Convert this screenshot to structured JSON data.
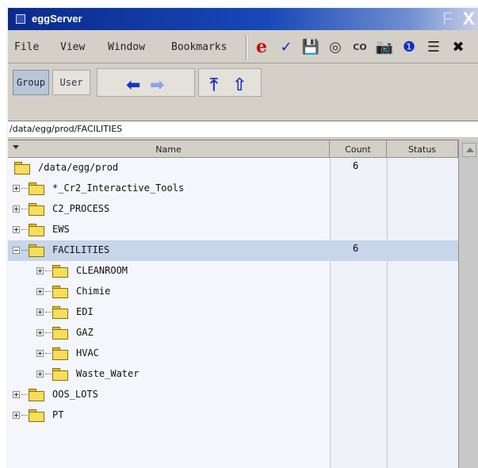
{
  "window": {
    "title": "eggServer",
    "min_glyph": "F",
    "close_glyph": "X"
  },
  "menu": {
    "items": [
      "File",
      "View",
      "Window",
      "Bookmarks"
    ]
  },
  "toolbar": {
    "icons": [
      {
        "name": "e-icon",
        "glyph": "e",
        "color": "#c01010"
      },
      {
        "name": "checkmark-icon",
        "glyph": "✓",
        "color": "#1020c0"
      },
      {
        "name": "save-icon",
        "glyph": "💾",
        "color": "#444444"
      },
      {
        "name": "cd-icon",
        "glyph": "◎",
        "color": "#333333"
      },
      {
        "name": "co-icon",
        "glyph": "CO",
        "color": "#333333"
      },
      {
        "name": "camera-icon",
        "glyph": "📷",
        "color": "#222222"
      },
      {
        "name": "info-icon",
        "glyph": "❶",
        "color": "#1030c0"
      },
      {
        "name": "list-icon",
        "glyph": "☰",
        "color": "#222222"
      },
      {
        "name": "close-icon",
        "glyph": "✖",
        "color": "#111111"
      }
    ]
  },
  "nav": {
    "group_label": "Group",
    "user_label": "User"
  },
  "path": {
    "value": "/data/egg/prod/FACILITIES"
  },
  "table": {
    "columns": [
      "Name",
      "Count",
      "Status"
    ],
    "rows": [
      {
        "label": "/data/egg/prod",
        "count": "6",
        "level": 0,
        "expander": "none",
        "selected": false
      },
      {
        "label": "*_Cr2_Interactive_Tools",
        "count": "",
        "level": 1,
        "expander": "plus",
        "selected": false
      },
      {
        "label": "C2_PROCESS",
        "count": "",
        "level": 1,
        "expander": "plus",
        "selected": false
      },
      {
        "label": "EWS",
        "count": "",
        "level": 1,
        "expander": "plus",
        "selected": false
      },
      {
        "label": "FACILITIES",
        "count": "6",
        "level": 1,
        "expander": "minus",
        "selected": true
      },
      {
        "label": "CLEANROOM",
        "count": "",
        "level": 2,
        "expander": "plus",
        "selected": false
      },
      {
        "label": "Chimie",
        "count": "",
        "level": 2,
        "expander": "plus",
        "selected": false
      },
      {
        "label": "EDI",
        "count": "",
        "level": 2,
        "expander": "plus",
        "selected": false
      },
      {
        "label": "GAZ",
        "count": "",
        "level": 2,
        "expander": "plus",
        "selected": false
      },
      {
        "label": "HVAC",
        "count": "",
        "level": 2,
        "expander": "plus",
        "selected": false
      },
      {
        "label": "Waste_Water",
        "count": "",
        "level": 2,
        "expander": "plus",
        "selected": false
      },
      {
        "label": "OOS_LOTS",
        "count": "",
        "level": 1,
        "expander": "plus",
        "selected": false
      },
      {
        "label": "PT",
        "count": "",
        "level": 1,
        "expander": "plus",
        "selected": false
      }
    ]
  },
  "colors": {
    "selected_row": "#c7d6ea",
    "folder": "#f5de5a",
    "titlebar": "#1848b8"
  }
}
